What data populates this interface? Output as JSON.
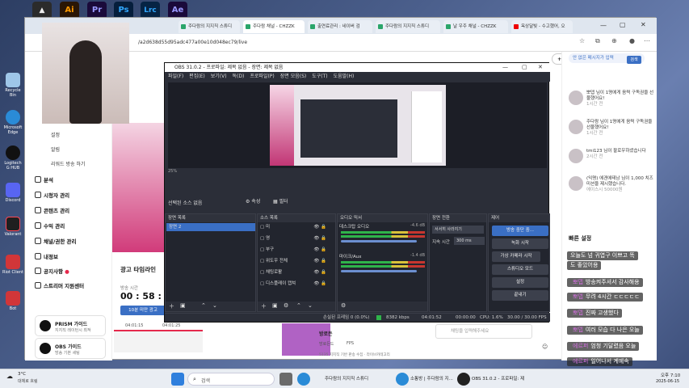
{
  "desktop": {
    "icons": [
      {
        "label": "Recycle Bin"
      },
      {
        "label": "Microsoft Edge"
      },
      {
        "label": "Logitech G HUB"
      },
      {
        "label": "Discord"
      },
      {
        "label": "Valorant"
      },
      {
        "label": "Riot Client"
      },
      {
        "label": "Bot"
      }
    ],
    "top_apps": [
      {
        "label": "Ai",
        "color": "#2a1605",
        "fg": "#ff9a00"
      },
      {
        "label": "Pr",
        "color": "#1a0a3a",
        "fg": "#9999ff"
      },
      {
        "label": "Ps",
        "color": "#061e3c",
        "fg": "#31a8ff"
      },
      {
        "label": "Lrc",
        "color": "#062444",
        "fg": "#31a8ff"
      },
      {
        "label": "Ae",
        "color": "#1a0a3a",
        "fg": "#9999ff"
      }
    ]
  },
  "browser": {
    "tabs": [
      {
        "label": "주다람의 지지직 스튜디"
      },
      {
        "label": "주다람 채널 - CHZZK"
      },
      {
        "label": "출연료관리 : 네이버 검"
      },
      {
        "label": "주다람의 지지직 스튜디"
      },
      {
        "label": "날 우주 채널 - CHZZK"
      },
      {
        "label": "옥상달빛 - 수고했어, 오"
      }
    ],
    "url": "/a2d638d55d95adc477a00e10d048ec79/live",
    "follow_button": "+ 만들기"
  },
  "studio": {
    "submenu": [
      "설정",
      "알림",
      "리워드 방송 하기"
    ],
    "menu": [
      "분석",
      "시청자 관리",
      "콘텐츠 관리",
      "수익 관리",
      "채널/권한 관리",
      "내정보",
      "공지사항",
      "스트리머 지원센터"
    ],
    "cards": [
      {
        "title": "PRISM 가이드",
        "sub": "지지직 레이턴시 최적"
      },
      {
        "title": "OBS 가이드",
        "sub": "방송 기본 세팅"
      }
    ],
    "ad_title": "광고 타임라인",
    "broadcast_time_label": "방송 시간",
    "broadcast_time": "00 : 58 : 51",
    "ad_button": "10분 미만 광고",
    "timeline_ticks": [
      "04:01:15",
      "04:01:25"
    ],
    "chat_input_placeholder": "채팅을 입력해주세요",
    "quiz_title": "방로든",
    "quiz_chips": [
      "방로든드",
      "FPS"
    ],
    "quiz_desc": "5135 지지직 기반 판송 수집 · 라이브카테고리"
  },
  "chatpanel": {
    "chat_input": "안 없은 메시지가 입력",
    "search_button": "검색",
    "notifications": [
      {
        "text": "뽀뎁 님이 1명에게 음력 구독권을 선물했어요!",
        "time": "1시간 전"
      },
      {
        "text": "주다람 님이 1명에게 음력 구독권을 선물했어요!",
        "time": "1시간 전"
      },
      {
        "text": "tmi123 님이 팔로우하셨습니다",
        "time": "2시간 전"
      },
      {
        "text": "(익명) 에겐에테남 님이 1,000 치즈 미션을 제시했습니다.",
        "time": "에이스시 50000원"
      }
    ],
    "quick_settings": "빠른 설정"
  },
  "obs": {
    "title": "OBS 31.0.2 - 프로파일: 제목 없음 - 장면: 제목 없음",
    "menu": [
      "파일(F)",
      "편집(E)",
      "보기(V)",
      "독(D)",
      "프로파일(P)",
      "장면 모음(S)",
      "도구(T)",
      "도움말(H)"
    ],
    "zoom": "25%",
    "source_none": "선택된 소스 없음",
    "properties_btn": "속성",
    "filters_btn": "필터",
    "docks": {
      "scenes": {
        "title": "장면 목록",
        "items": [
          "장면 2"
        ]
      },
      "sources": {
        "title": "소스 목록",
        "items": [
          "미",
          "영",
          "부구",
          "위도우 전체",
          "채팅로활",
          "디스플레이 캡쳐"
        ]
      },
      "mixer": {
        "title": "오디오 믹서",
        "tracks": [
          {
            "name": "데스크탑 오디오",
            "level": "-4.6 dB"
          },
          {
            "name": "마이크/Aux",
            "level": "-1.4 dB"
          }
        ]
      },
      "transitions": {
        "title": "장면 전환",
        "type": "서서히 사라지기",
        "duration_label": "지속 시간",
        "duration": "300 ms"
      },
      "controls": {
        "title": "제어",
        "buttons": [
          "방송 중단 중...",
          "녹화 시작",
          "가상 카메라 시작",
          "스튜디오 모드",
          "설정",
          "끝내기"
        ]
      }
    },
    "status": {
      "frames": "손실된 프레임 0 (0.0%)",
      "bitrate": "8382 kbps",
      "live_time": "04:01:52",
      "rec_time": "00:00:00",
      "cpu": "CPU: 1.6%",
      "fps": "30.00 / 30.00 FPS"
    }
  },
  "overlay_chat": [
    {
      "name": "",
      "text": "오늘도 넘 귀엽구 이쁘고 똑"
    },
    {
      "name": "",
      "text": "도 좋았어용"
    },
    {
      "name": "뽀뎁",
      "text": "방송켜주셔서 감사해용"
    },
    {
      "name": "뽀뎁",
      "text": "무려 4시간 ㄷㄷㄷㄷㄷ"
    },
    {
      "name": "뽀뎁",
      "text": "진짜 고생했다"
    },
    {
      "name": "뽀뎁",
      "text": "여러 모습 다 나은 오늘"
    },
    {
      "name": "에르퍼",
      "text": "엄청 기달렸음 오늘"
    },
    {
      "name": "에르퍼",
      "text": "일어나서 계예속"
    }
  ],
  "taskbar": {
    "weather_temp": "3°C",
    "weather_desc": "대체로 흐림",
    "search_placeholder": "검색",
    "items": [
      "주다람의 지지직 스튜디",
      "소통방 | 주다람의 지...",
      "OBS 31.0.2 - 프로파일: 제"
    ],
    "time": "오후 7:10",
    "date": "2025-06-15"
  },
  "colors": {
    "accent": "#3a6fc4",
    "chzzk_green": "#2aa56a",
    "live_red": "#e5294c"
  }
}
